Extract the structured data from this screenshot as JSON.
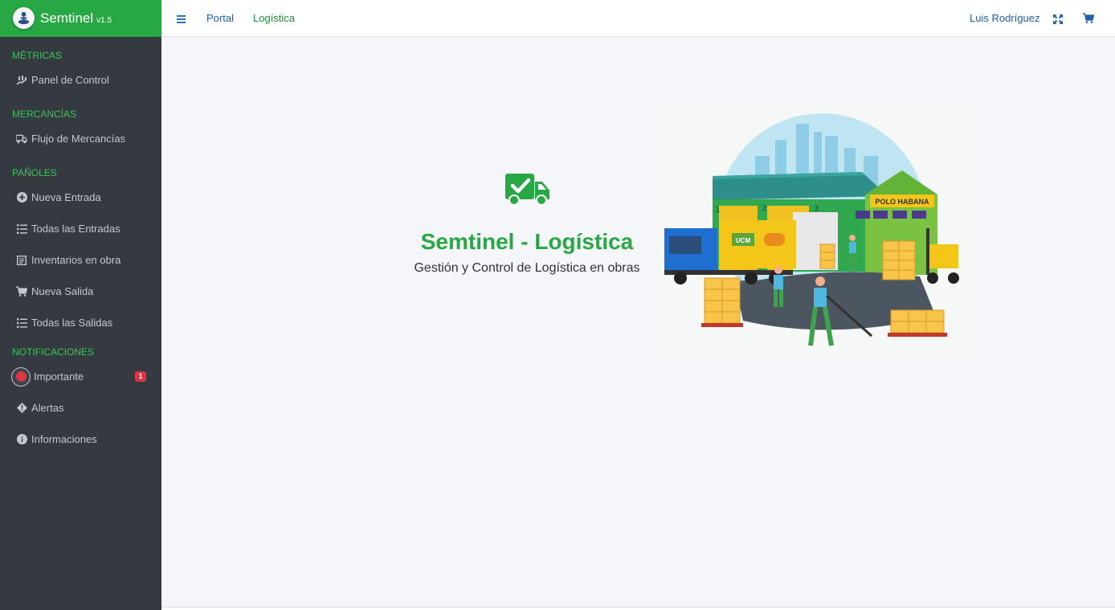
{
  "brand": {
    "name": "Semtinel",
    "version": "v1.5"
  },
  "sidebar": {
    "sections": [
      {
        "header": "MÉTRICAS",
        "items": [
          {
            "label": "Panel de Control",
            "icon": "chart-hand-icon"
          }
        ]
      },
      {
        "header": "MERCANCÍAS",
        "items": [
          {
            "label": "Flujo de Mercancías",
            "icon": "shipping-icon"
          }
        ]
      },
      {
        "header": "PAÑOLES",
        "items": [
          {
            "label": "Nueva Entrada",
            "icon": "plus-circle-icon"
          },
          {
            "label": "Todas las Entradas",
            "icon": "list-icon"
          },
          {
            "label": "Inventarios en obra",
            "icon": "clipboard-icon"
          },
          {
            "label": "Nueva Salida",
            "icon": "cart-icon"
          },
          {
            "label": "Todas las Salidas",
            "icon": "list-icon"
          }
        ]
      },
      {
        "header": "NOTIFICACIONES",
        "items": [
          {
            "label": "Importante",
            "icon": "important-dot-icon",
            "badge": "1"
          },
          {
            "label": "Alertas",
            "icon": "warning-diamond-icon"
          },
          {
            "label": "Informaciones",
            "icon": "info-icon"
          }
        ]
      }
    ]
  },
  "topbar": {
    "links": [
      "Portal",
      "Logística"
    ],
    "user": "Luis Rodríguez"
  },
  "hero": {
    "title": "Semtinel - Logística",
    "subtitle": "Gestión y Control de Logística en obras"
  },
  "illustration": {
    "warehouse_sign": "POLO HABANA",
    "truck_logo": "UCM",
    "door_numbers": [
      "1",
      "2",
      "3"
    ]
  },
  "colors": {
    "brand_green": "#28a745",
    "sidebar_bg": "#343a40",
    "link_blue": "#1d5fa8",
    "badge_red": "#dc3545"
  }
}
